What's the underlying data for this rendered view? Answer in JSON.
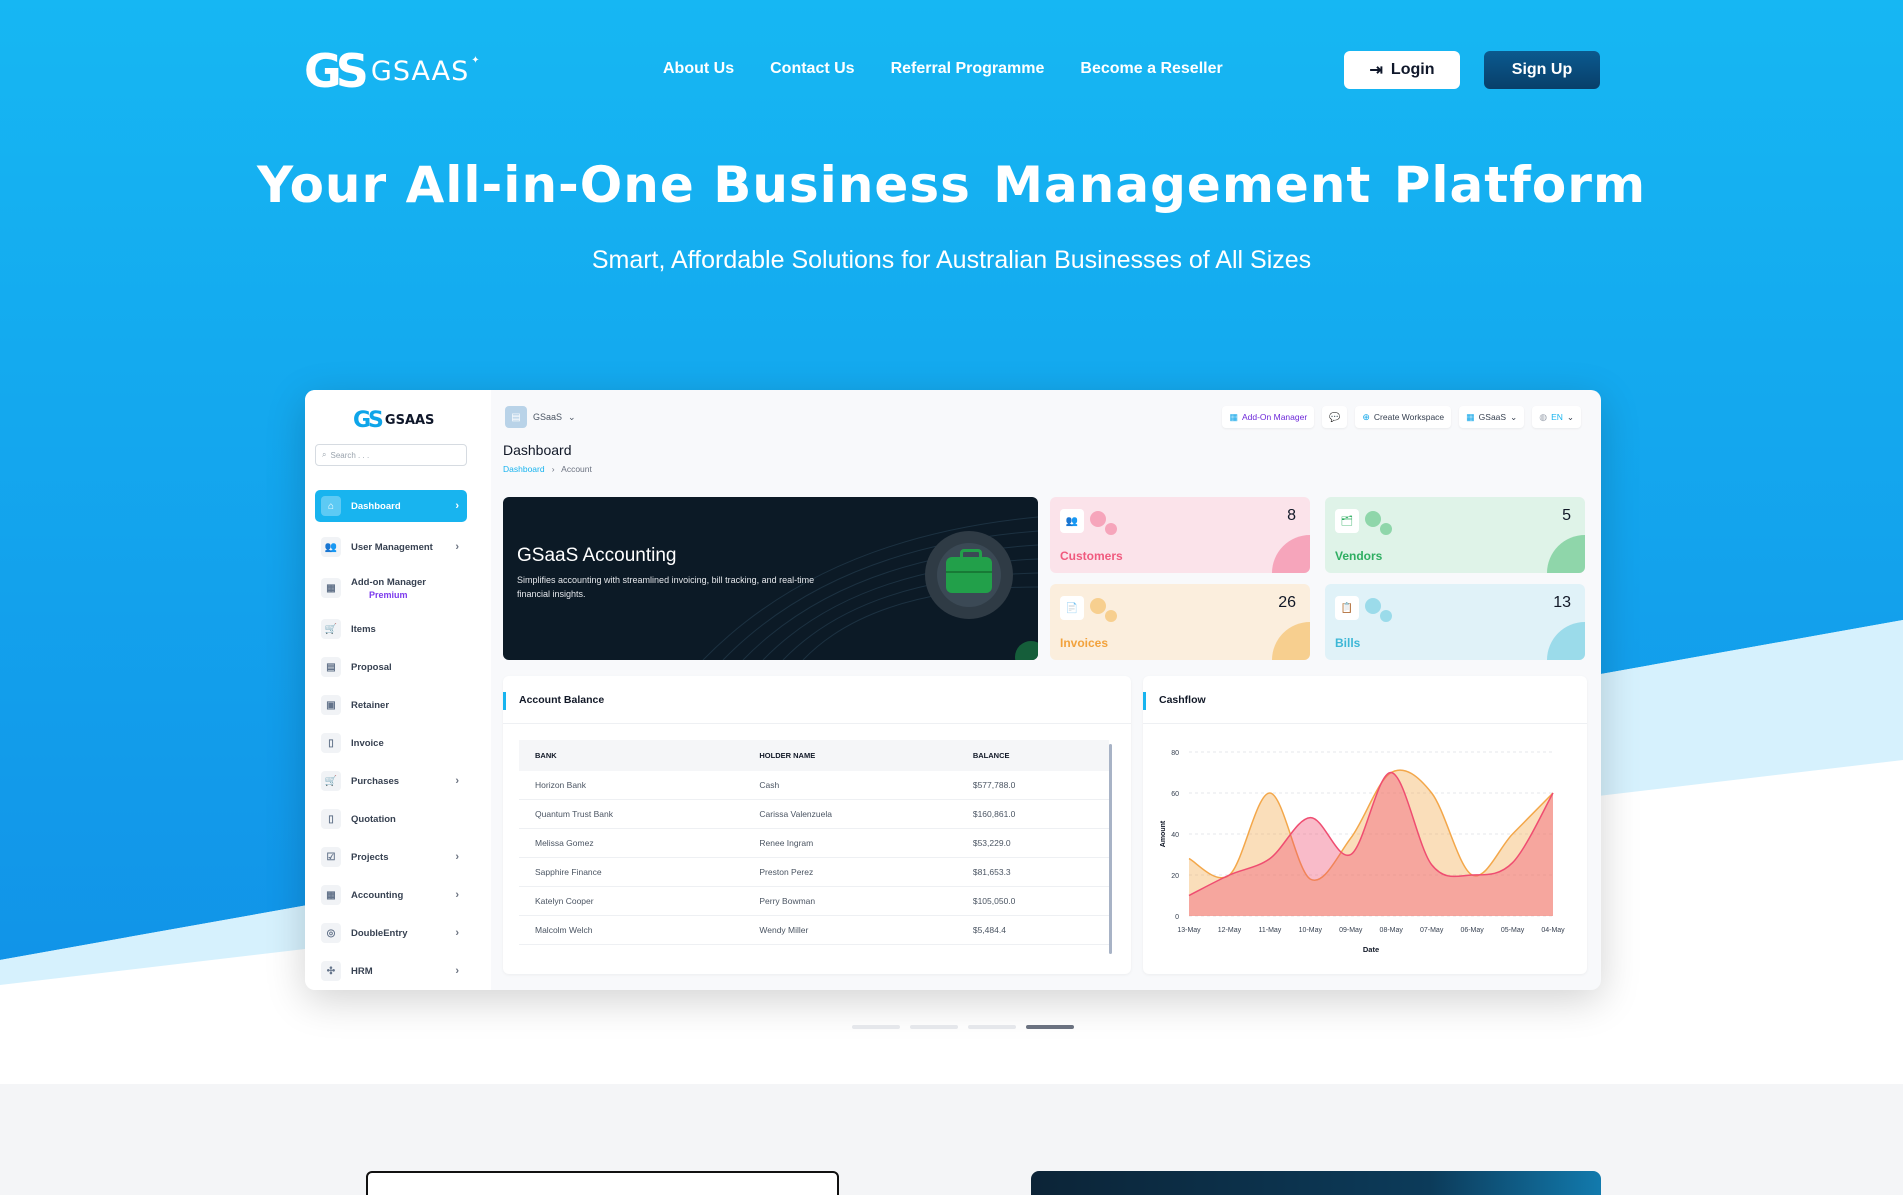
{
  "nav": {
    "logo_text": "GSAAS",
    "links": [
      "About Us",
      "Contact Us",
      "Referral Programme",
      "Become a Reseller"
    ],
    "login_label": "Login",
    "signup_label": "Sign Up"
  },
  "hero": {
    "title_pre": "Your All-in-One Business",
    "title_highlight": "Management",
    "title_post": "Platform",
    "subtitle": "Smart, Affordable Solutions for Australian Businesses of All Sizes"
  },
  "app": {
    "logo_text": "GSAAS",
    "search_placeholder": "Search . . .",
    "workspace": "GSaaS",
    "top_buttons": {
      "addon": "Add-On Manager",
      "create": "Create Workspace",
      "gsaas": "GSaaS",
      "lang": "EN"
    },
    "page_title": "Dashboard",
    "breadcrumb": {
      "home": "Dashboard",
      "current": "Account"
    },
    "sidebar": [
      {
        "label": "Dashboard",
        "icon": "home-icon",
        "chevron": true
      },
      {
        "label": "User Management",
        "icon": "users-icon",
        "chevron": true
      },
      {
        "label": "Add-on Manager",
        "sub": "Premium",
        "icon": "grid-icon",
        "chevron": false
      },
      {
        "label": "Items",
        "icon": "cart-icon",
        "chevron": false
      },
      {
        "label": "Proposal",
        "icon": "proposal-icon",
        "chevron": false
      },
      {
        "label": "Retainer",
        "icon": "retainer-icon",
        "chevron": false
      },
      {
        "label": "Invoice",
        "icon": "invoice-icon",
        "chevron": false
      },
      {
        "label": "Purchases",
        "icon": "cart-icon",
        "chevron": true
      },
      {
        "label": "Quotation",
        "icon": "quotation-icon",
        "chevron": false
      },
      {
        "label": "Projects",
        "icon": "projects-icon",
        "chevron": true
      },
      {
        "label": "Accounting",
        "icon": "accounting-icon",
        "chevron": true
      },
      {
        "label": "DoubleEntry",
        "icon": "doubleentry-icon",
        "chevron": true
      },
      {
        "label": "HRM",
        "icon": "hrm-icon",
        "chevron": true
      }
    ],
    "banner": {
      "title": "GSaaS Accounting",
      "desc": "Simplifies accounting with streamlined invoicing, bill tracking, and real-time financial insights."
    },
    "stats": [
      {
        "label": "Customers",
        "value": "8",
        "color": "#f05a7e",
        "bg": "#fbe3ea",
        "blob": "#f6a5bb"
      },
      {
        "label": "Vendors",
        "value": "5",
        "color": "#2fae62",
        "bg": "#dff3e8",
        "blob": "#8fd6aa"
      },
      {
        "label": "Invoices",
        "value": "26",
        "color": "#f2a23c",
        "bg": "#fbeedd",
        "blob": "#f7cf8f"
      },
      {
        "label": "Bills",
        "value": "13",
        "color": "#3db7d6",
        "bg": "#e0f2f8",
        "blob": "#9bdbea"
      }
    ],
    "account_balance": {
      "title": "Account Balance",
      "headers": [
        "BANK",
        "HOLDER NAME",
        "BALANCE"
      ],
      "rows": [
        [
          "Horizon Bank",
          "Cash",
          "$577,788.0"
        ],
        [
          "Quantum Trust Bank",
          "Carissa Valenzuela",
          "$160,861.0"
        ],
        [
          "Melissa Gomez",
          "Renee Ingram",
          "$53,229.0"
        ],
        [
          "Sapphire Finance",
          "Preston Perez",
          "$81,653.3"
        ],
        [
          "Katelyn Cooper",
          "Perry Bowman",
          "$105,050.0"
        ],
        [
          "Malcolm Welch",
          "Wendy Miller",
          "$5,484.4"
        ]
      ]
    }
  },
  "chart_data": {
    "type": "area",
    "title": "Cashflow",
    "xlabel": "Date",
    "ylabel": "Amount",
    "ylim": [
      0,
      80
    ],
    "yticks": [
      0,
      20,
      40,
      60,
      80
    ],
    "categories": [
      "13-May",
      "12-May",
      "11-May",
      "10-May",
      "09-May",
      "08-May",
      "07-May",
      "06-May",
      "05-May",
      "04-May"
    ],
    "grid": true,
    "series": [
      {
        "name": "",
        "color": "#f3a74a",
        "values": [
          28,
          20,
          60,
          18,
          38,
          70,
          60,
          20,
          40,
          60
        ]
      },
      {
        "name": "",
        "color": "#ef4d71",
        "values": [
          10,
          20,
          28,
          48,
          30,
          70,
          25,
          20,
          26,
          60
        ]
      }
    ]
  },
  "carousel": {
    "count": 4,
    "active": 3
  }
}
